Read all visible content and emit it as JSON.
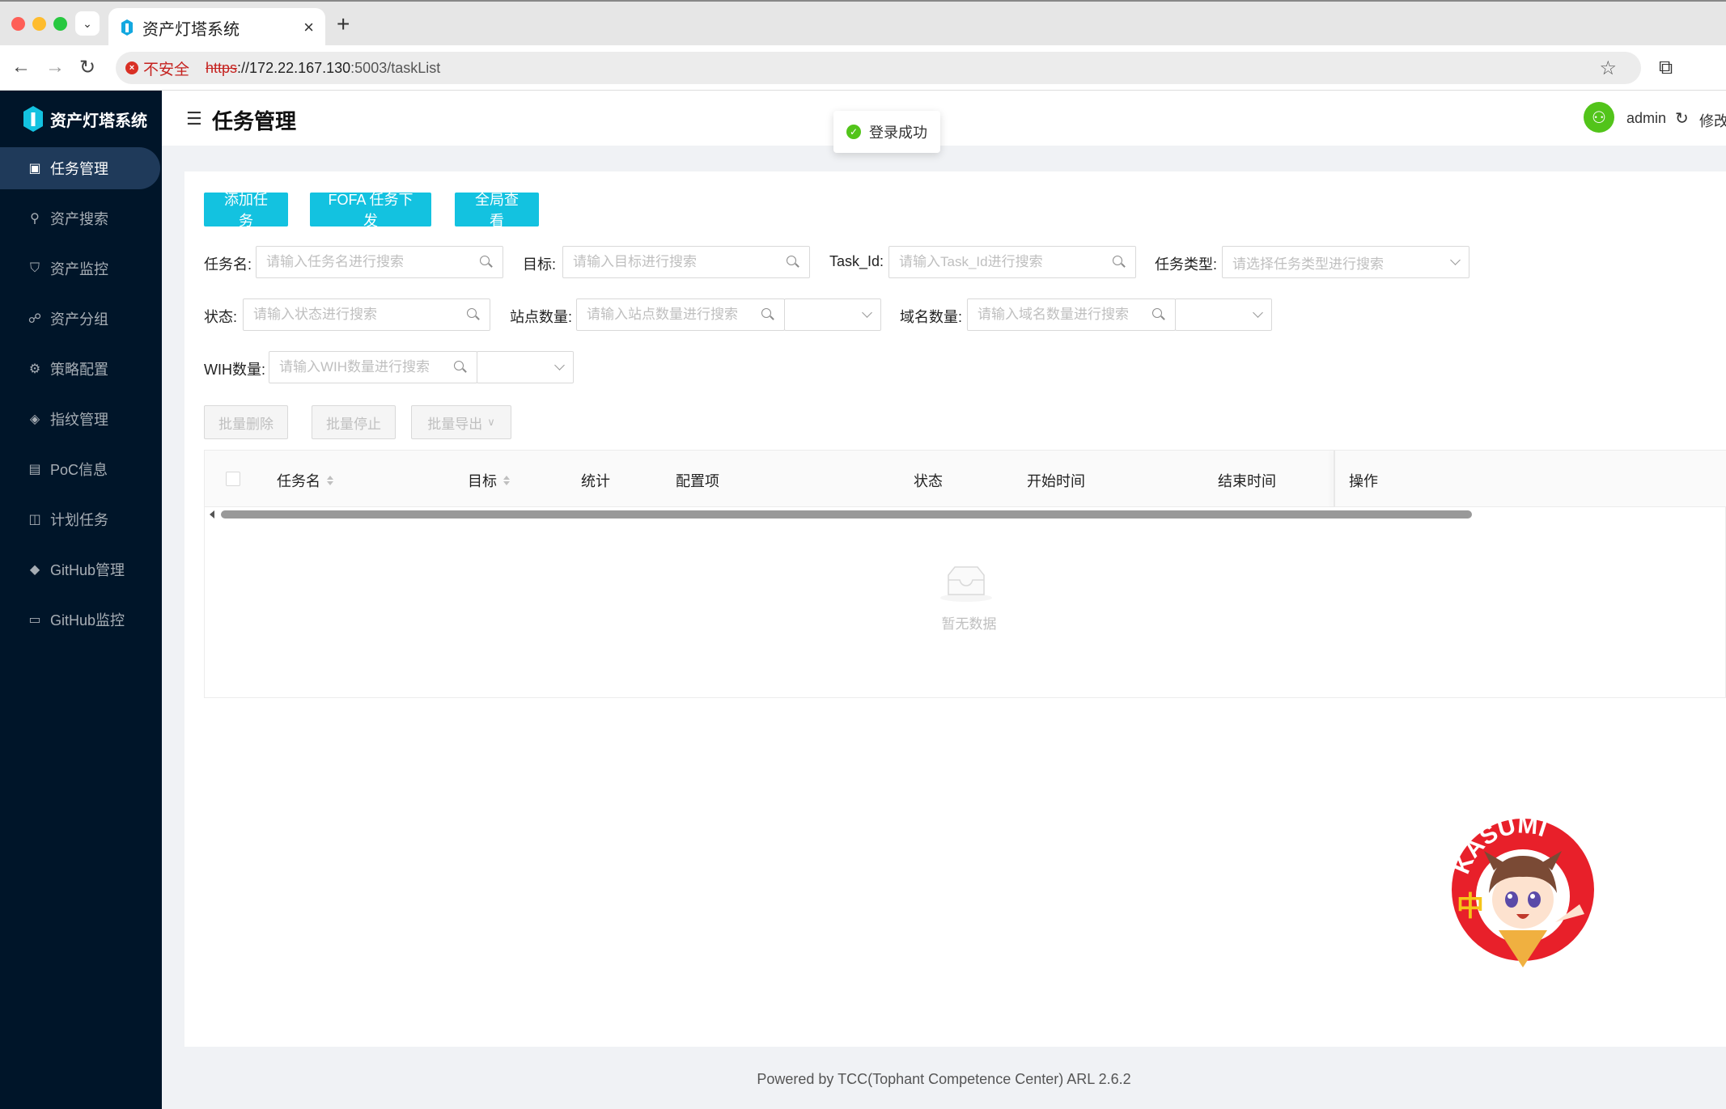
{
  "browser": {
    "tab_title": "资产灯塔系统",
    "tab_close": "×",
    "new_tab": "+",
    "security_label": "不安全",
    "url_scheme": "https",
    "url_host": "://172.22.167.130",
    "url_rest": ":5003/taskList",
    "colors": {
      "insecure": "#c5221f"
    }
  },
  "sidebar": {
    "logo_text": "资产灯塔系统",
    "items": [
      {
        "label": "任务管理",
        "icon": "task-icon",
        "active": true
      },
      {
        "label": "资产搜索",
        "icon": "search-icon"
      },
      {
        "label": "资产监控",
        "icon": "shield-icon"
      },
      {
        "label": "资产分组",
        "icon": "cluster-icon"
      },
      {
        "label": "策略配置",
        "icon": "settings-icon"
      },
      {
        "label": "指纹管理",
        "icon": "fingerprint-icon"
      },
      {
        "label": "PoC信息",
        "icon": "file-icon"
      },
      {
        "label": "计划任务",
        "icon": "schedule-icon"
      },
      {
        "label": "GitHub管理",
        "icon": "github-icon"
      },
      {
        "label": "GitHub监控",
        "icon": "monitor-icon"
      }
    ]
  },
  "header": {
    "title": "任务管理",
    "username": "admin",
    "modify_label": "修改"
  },
  "toast": {
    "text": "登录成功"
  },
  "toolbar": {
    "add_task": "添加任务",
    "fofa_task": "FOFA 任务下发",
    "global_view": "全局查看",
    "batch_delete": "批量删除",
    "batch_stop": "批量停止",
    "batch_export": "批量导出"
  },
  "filters": {
    "task_name_label": "任务名:",
    "task_name_placeholder": "请输入任务名进行搜索",
    "target_label": "目标:",
    "target_placeholder": "请输入目标进行搜索",
    "task_id_label": "Task_Id:",
    "task_id_placeholder": "请输入Task_Id进行搜索",
    "task_type_label": "任务类型:",
    "task_type_placeholder": "请选择任务类型进行搜索",
    "status_label": "状态:",
    "status_placeholder": "请输入状态进行搜索",
    "site_count_label": "站点数量:",
    "site_count_placeholder": "请输入站点数量进行搜索",
    "domain_count_label": "域名数量:",
    "domain_count_placeholder": "请输入域名数量进行搜索",
    "wih_count_label": "WIH数量:",
    "wih_count_placeholder": "请输入WIH数量进行搜索"
  },
  "table": {
    "columns": [
      "任务名",
      "目标",
      "统计",
      "配置项",
      "状态",
      "开始时间",
      "结束时间",
      "操作"
    ],
    "empty_text": "暂无数据"
  },
  "sticker": {
    "text": "KASUMI",
    "badge": "中"
  },
  "footer": {
    "text": "Powered by TCC(Tophant Competence Center) ARL 2.6.2"
  }
}
